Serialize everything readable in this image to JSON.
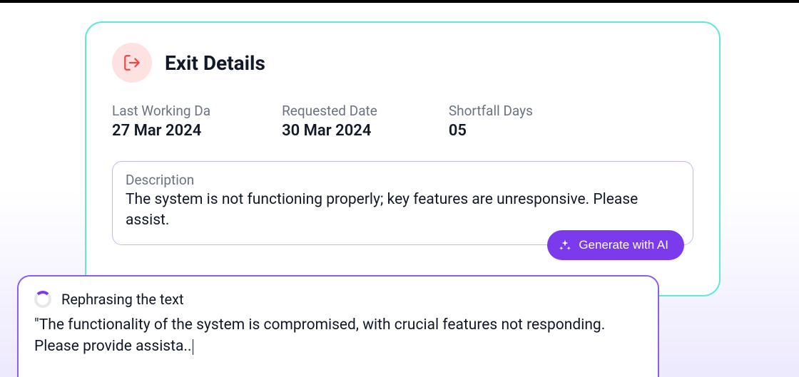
{
  "card": {
    "title": "Exit Details",
    "details": {
      "last_working_day": {
        "label": "Last Working Da",
        "value": "27 Mar 2024"
      },
      "requested_date": {
        "label": "Requested Date",
        "value": "30 Mar 2024"
      },
      "shortfall_days": {
        "label": "Shortfall Days",
        "value": "05"
      }
    },
    "description": {
      "label": "Description",
      "text": "The system is not functioning properly; key features are unresponsive. Please assist."
    },
    "generate_button_label": "Generate with AI"
  },
  "rephrase": {
    "title": "Rephrasing the text",
    "text": "\"The functionality of the system is compromised, with crucial features not responding. Please provide assista.."
  }
}
